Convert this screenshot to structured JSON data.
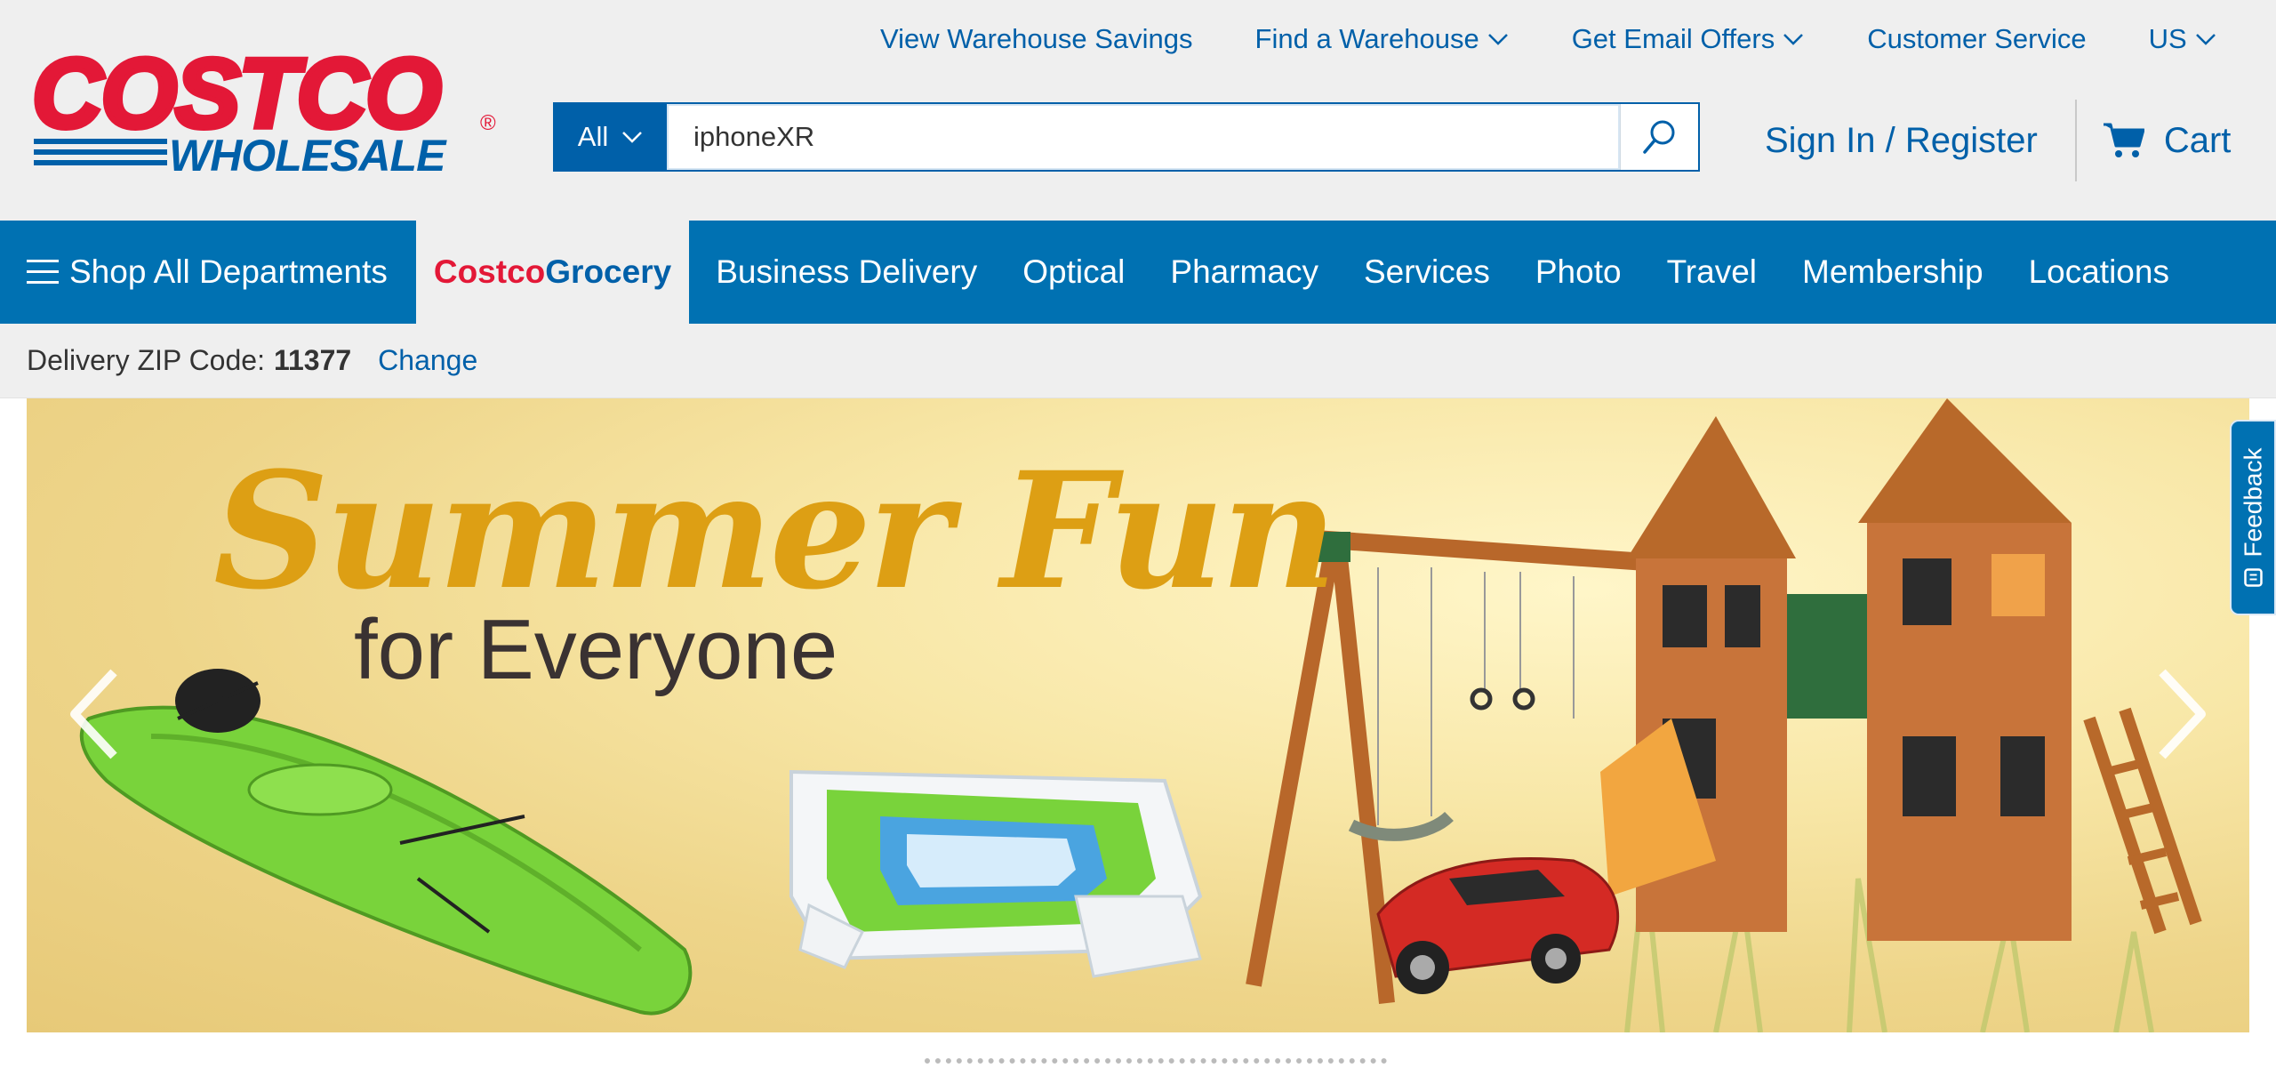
{
  "brand": {
    "logo_line1": "COSTCO",
    "logo_line2": "WHOLESALE",
    "registered_mark": "®",
    "primary_red": "#e31837",
    "primary_blue": "#0060a9"
  },
  "utility_nav": {
    "items": [
      {
        "label": "View Warehouse Savings",
        "has_dropdown": false
      },
      {
        "label": "Find a Warehouse",
        "has_dropdown": true
      },
      {
        "label": "Get Email Offers",
        "has_dropdown": true
      },
      {
        "label": "Customer Service",
        "has_dropdown": false
      },
      {
        "label": "US",
        "has_dropdown": true
      }
    ]
  },
  "search": {
    "category_label": "All",
    "query": "iphoneXR",
    "icon": "search-icon"
  },
  "account": {
    "sign_in_label": "Sign In / Register",
    "cart_label": "Cart",
    "cart_icon": "cart-icon"
  },
  "main_nav": {
    "shop_all_label": "Shop All Departments",
    "grocery_part1": "Costco",
    "grocery_part2": "Grocery",
    "items": [
      "Business Delivery",
      "Optical",
      "Pharmacy",
      "Services",
      "Photo",
      "Travel",
      "Membership",
      "Locations"
    ]
  },
  "zip_bar": {
    "label": "Delivery ZIP Code:",
    "zip": "11377",
    "change_label": "Change"
  },
  "hero": {
    "title": "Summer Fun",
    "subtitle": "for Everyone",
    "prev_icon": "chevron-left-icon",
    "next_icon": "chevron-right-icon"
  },
  "feedback": {
    "label": "Feedback"
  }
}
